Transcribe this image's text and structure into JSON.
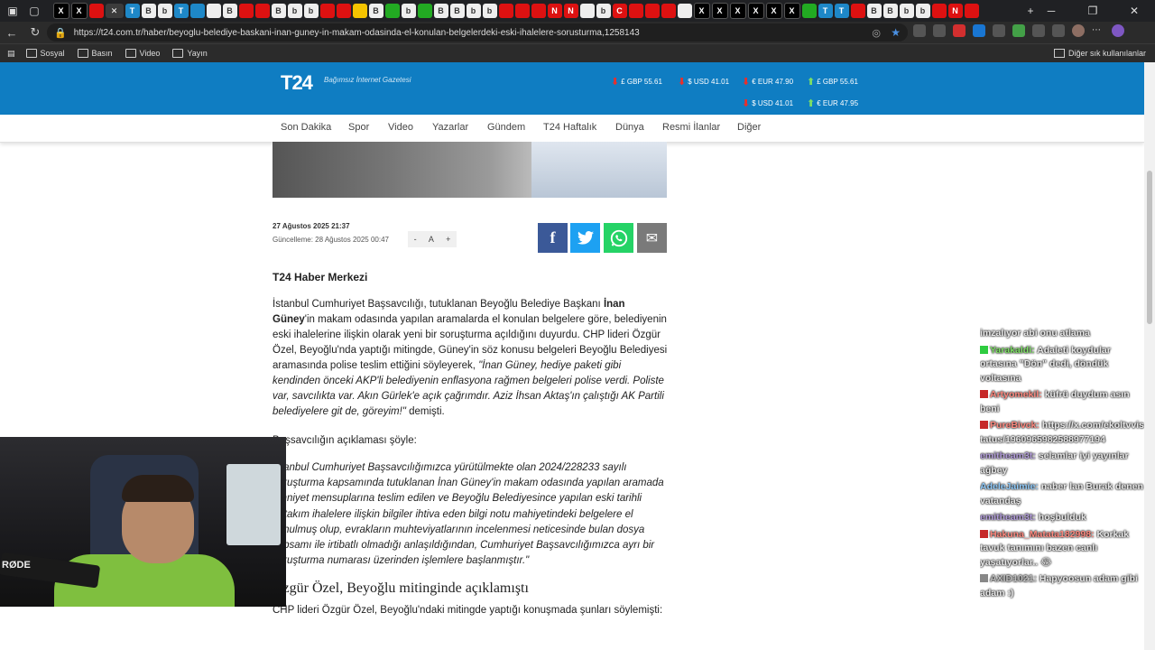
{
  "browser": {
    "url": "https://t24.com.tr/haber/beyoglu-belediye-baskani-inan-guney-in-makam-odasinda-el-konulan-belgelerdeki-eski-ihalelere-sorusturma,1258143",
    "bookmarks": [
      "Sosyal",
      "Basın",
      "Video",
      "Yayın"
    ],
    "bookmarks_right": "Diğer sık kullanılanlar"
  },
  "site": {
    "logo": "T24",
    "tagline": "Bağımsız İnternet Gazetesi",
    "fx": [
      {
        "dir": "down",
        "sym": "£",
        "label": "GBP 55.61"
      },
      {
        "dir": "down",
        "sym": "$",
        "label": "USD 41.01"
      },
      {
        "dir": "down",
        "sym": "€",
        "label": "EUR 47.90"
      },
      {
        "dir": "up",
        "sym": "£",
        "label": "GBP 55.61"
      },
      {
        "dir": "down",
        "sym": "$",
        "label": "USD 41.01"
      },
      {
        "dir": "up",
        "sym": "€",
        "label": "EUR 47.95"
      }
    ],
    "menu": [
      "Son Dakika",
      "Spor",
      "Video",
      "Yazarlar",
      "Gündem",
      "T24 Haftalık",
      "Dünya",
      "Resmi İlanlar",
      "Diğer"
    ]
  },
  "article": {
    "published": "27 Ağustos 2025 21:37",
    "updated": "Güncelleme: 28 Ağustos 2025 00:47",
    "font_controls": [
      "-",
      "A",
      "+"
    ],
    "byline": "T24 Haber Merkezi",
    "p1_a": "İstanbul Cumhuriyet Başsavcılığı, tutuklanan Beyoğlu Belediye Başkanı ",
    "p1_b": "İnan Güney",
    "p1_c": "'in makam odasında yapılan aramalarda el konulan belgelere göre, belediyenin eski ihalelerine ilişkin olarak yeni bir soruşturma açıldığını duyurdu. CHP lideri Özgür Özel, Beyoğlu'nda yaptığı mitingde, Güney'in söz konusu belgeleri Beyoğlu Belediyesi aramasında polise teslim ettiğini söyleyerek, ",
    "p1_d": "\"İnan Güney, hediye paketi gibi kendinden önceki AKP'li belediyenin enflasyona rağmen belgeleri polise verdi. Poliste var, savcılıkta var. Akın Gürlek'e açık çağrımdır. Aziz İhsan Aktaş'ın çalıştığı AK Partili belediyelere git de, göreyim!\"",
    "p1_e": " demişti.",
    "p2": "Başsavcılığın açıklaması şöyle:",
    "quote": "İstanbul Cumhuriyet Başsavcılığımızca yürütülmekte olan 2024/228233 sayılı soruşturma kapsamında tutuklanan İnan Güney'in makam odasında yapılan aramada emniyet mensuplarına teslim edilen ve Beyoğlu Belediyesince yapılan eski tarihli birtakım ihalelere ilişkin bilgiler ihtiva eden bilgi notu mahiyetindeki belgelere el konulmuş olup, evrakların muhteviyatlarının incelenmesi neticesinde bulan dosya kapsamı ile irtibatlı olmadığı anlaşıldığından, Cumhuriyet Başsavcılığımızca ayrı bir soruşturma numarası üzerinden işlemlere başlanmıştır.\"",
    "h2": "Özgür Özel, Beyoğlu mitinginde açıklamıştı",
    "p3": "CHP lideri Özgür Özel, Beyoğlu'ndaki mitingde yaptığı konuşmada şunları söylemişti:"
  },
  "webcam": {
    "mic_brand": "RØDE"
  },
  "chat": [
    {
      "user": "",
      "text": "imzalıyor abi onu atlama",
      "color": "#ffffff",
      "badge": ""
    },
    {
      "user": "Yarakaldi:",
      "text": "Adaleti koydular ortasına \"Dön\" dedi, döndük voltasına",
      "color": "#7ddf64",
      "badge": "#2ecc40"
    },
    {
      "user": "Artyomekil:",
      "text": "küfrü duydum asın beni",
      "color": "#ff8a80",
      "badge": "#c62828"
    },
    {
      "user": "PureBivck:",
      "text": "https://x.com/ekoltvvis tatus/1960965982588977194",
      "color": "#ff8a80",
      "badge": "#c62828"
    },
    {
      "user": "emitheam3t:",
      "text": "selamlar iyi yayınlar ağbey",
      "color": "#b39ddb",
      "badge": ""
    },
    {
      "user": "AdeleJaimie:",
      "text": "naber lan Burak denen vatandaş",
      "color": "#90caf9",
      "badge": ""
    },
    {
      "user": "emitheam3t:",
      "text": "hoşbulduk",
      "color": "#b39ddb",
      "badge": ""
    },
    {
      "user": "Hakuna_Matata182998:",
      "text": "Korkak tavuk tanımını bazen canlı yaşatıyorlar.. 😂",
      "color": "#ff8a80",
      "badge": "#c62828"
    },
    {
      "user": "AXID1021:",
      "text": "Hapyoosun adam gibi adam :)",
      "color": "#bdbdbd",
      "badge": "#888888"
    }
  ]
}
